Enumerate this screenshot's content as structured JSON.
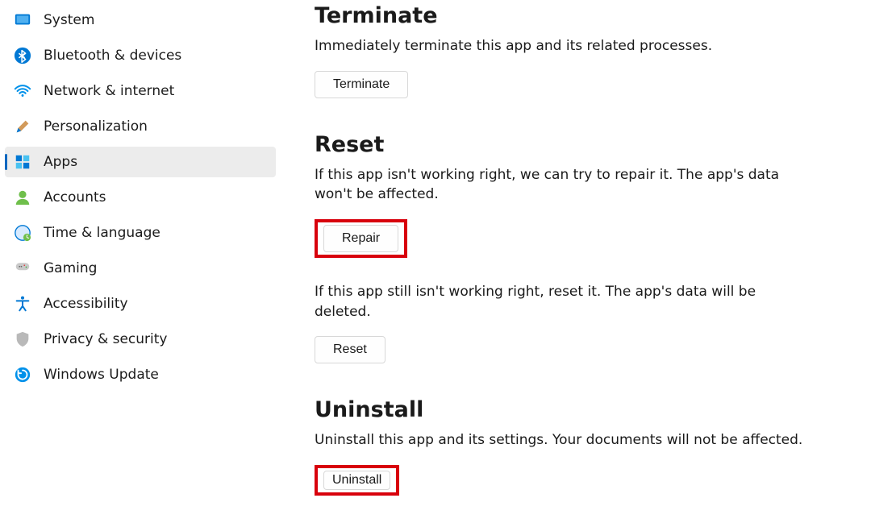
{
  "sidebar": {
    "items": [
      {
        "label": "System",
        "icon": "system",
        "selected": false
      },
      {
        "label": "Bluetooth & devices",
        "icon": "bluetooth",
        "selected": false
      },
      {
        "label": "Network & internet",
        "icon": "wifi",
        "selected": false
      },
      {
        "label": "Personalization",
        "icon": "personalization",
        "selected": false
      },
      {
        "label": "Apps",
        "icon": "apps",
        "selected": true
      },
      {
        "label": "Accounts",
        "icon": "accounts",
        "selected": false
      },
      {
        "label": "Time & language",
        "icon": "timelang",
        "selected": false
      },
      {
        "label": "Gaming",
        "icon": "gaming",
        "selected": false
      },
      {
        "label": "Accessibility",
        "icon": "accessibility",
        "selected": false
      },
      {
        "label": "Privacy & security",
        "icon": "privacy",
        "selected": false
      },
      {
        "label": "Windows Update",
        "icon": "update",
        "selected": false
      }
    ]
  },
  "terminate": {
    "title": "Terminate",
    "desc": "Immediately terminate this app and its related processes.",
    "button": "Terminate"
  },
  "reset": {
    "title": "Reset",
    "desc1": "If this app isn't working right, we can try to repair it. The app's data won't be affected.",
    "repair_button": "Repair",
    "desc2": "If this app still isn't working right, reset it. The app's data will be deleted.",
    "reset_button": "Reset"
  },
  "uninstall": {
    "title": "Uninstall",
    "desc": "Uninstall this app and its settings. Your documents will not be affected.",
    "button": "Uninstall"
  }
}
